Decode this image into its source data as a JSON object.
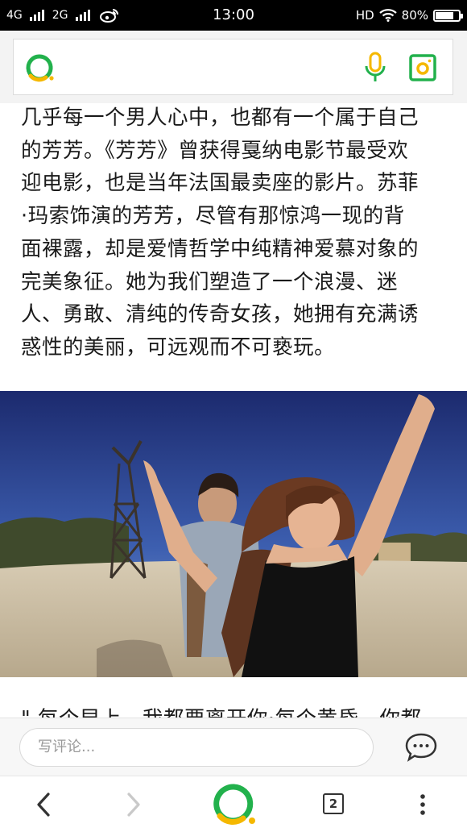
{
  "status_bar": {
    "network_1": "4G",
    "network_2": "2G",
    "time": "13:00",
    "hd": "HD",
    "battery": "80%",
    "battery_level": 0.8
  },
  "search": {
    "icons": [
      "app-logo-icon",
      "microphone-icon",
      "camera-scan-icon"
    ]
  },
  "article": {
    "paragraph_lines": [
      "几乎每一个男人心中，也都有一个属于自己",
      "的芳芳。《芳芳》曾获得戛纳电影节最受欢",
      "迎电影，也是当年法国最卖座的影片。苏菲",
      "·玛索饰演的芳芳，尽管有那惊鸿一现的背",
      "面裸露，却是爱情哲学中纯精神爱慕对象的",
      "完美象征。她为我们塑造了一个浪漫、迷",
      "人、勇敢、清纯的传奇女孩，她拥有充满诱",
      "惑性的美丽，可远观而不可亵玩。"
    ],
    "next_line_partial": "\" 每个早上，我都要离开你·每个黄昏，你都"
  },
  "comment": {
    "placeholder": "写评论..."
  },
  "nav": {
    "tab_count": "2"
  },
  "colors": {
    "brand_green": "#22b14c",
    "brand_yellow": "#f5b800"
  }
}
